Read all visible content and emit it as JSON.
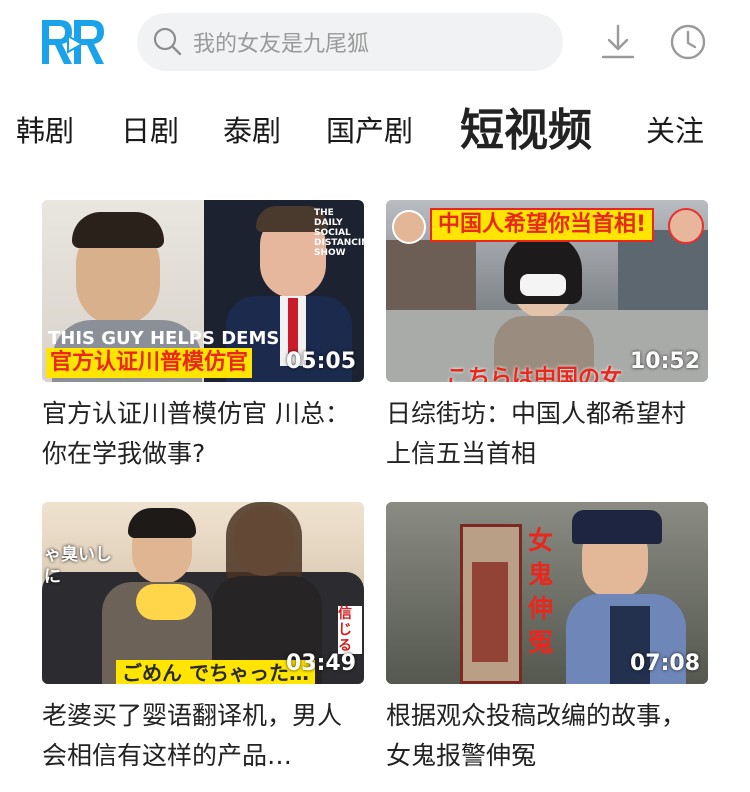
{
  "header": {
    "logo_text": "RR",
    "search_placeholder": "我的女友是九尾狐",
    "icons": [
      "search-icon",
      "download-icon",
      "history-icon"
    ]
  },
  "tabs": [
    {
      "label": "韩剧",
      "active": false
    },
    {
      "label": "日剧",
      "active": false
    },
    {
      "label": "泰剧",
      "active": false
    },
    {
      "label": "国产剧",
      "active": false
    },
    {
      "label": "短视频",
      "active": true
    },
    {
      "label": "关注",
      "active": false
    }
  ],
  "videos": [
    {
      "title": "官方认证川普模仿官 川总：你在学我做事?",
      "duration": "05:05",
      "thumb_caption": "官方认证川普模仿官",
      "thumb_overlay_en": "THIS GUY HELPS DEMS",
      "thumb_badge": "THE DAILY SOCIAL DISTANCING SHOW"
    },
    {
      "title": "日综街坊：中国人都希望村上信五当首相",
      "duration": "10:52",
      "thumb_caption": "中国人希望你当首相!",
      "thumb_subtitle_jp": "こちらは中国の女"
    },
    {
      "title": "老婆买了婴语翻译机，男人会相信有这样的产品…",
      "duration": "03:49",
      "thumb_caption_jp": "ごめん でちゃった…",
      "thumb_side_jp": "ゃ臭いしに",
      "thumb_side_jp2": "信じる"
    },
    {
      "title": "根据观众投稿改编的故事，女鬼报警伸冤",
      "duration": "07:08",
      "thumb_vertical": "女鬼伸冤"
    }
  ],
  "colors": {
    "logo_blue": "#1aa3e8",
    "search_bg": "#f1f2f4",
    "caption_yellow": "#ffe500",
    "caption_red": "#e8281e"
  }
}
